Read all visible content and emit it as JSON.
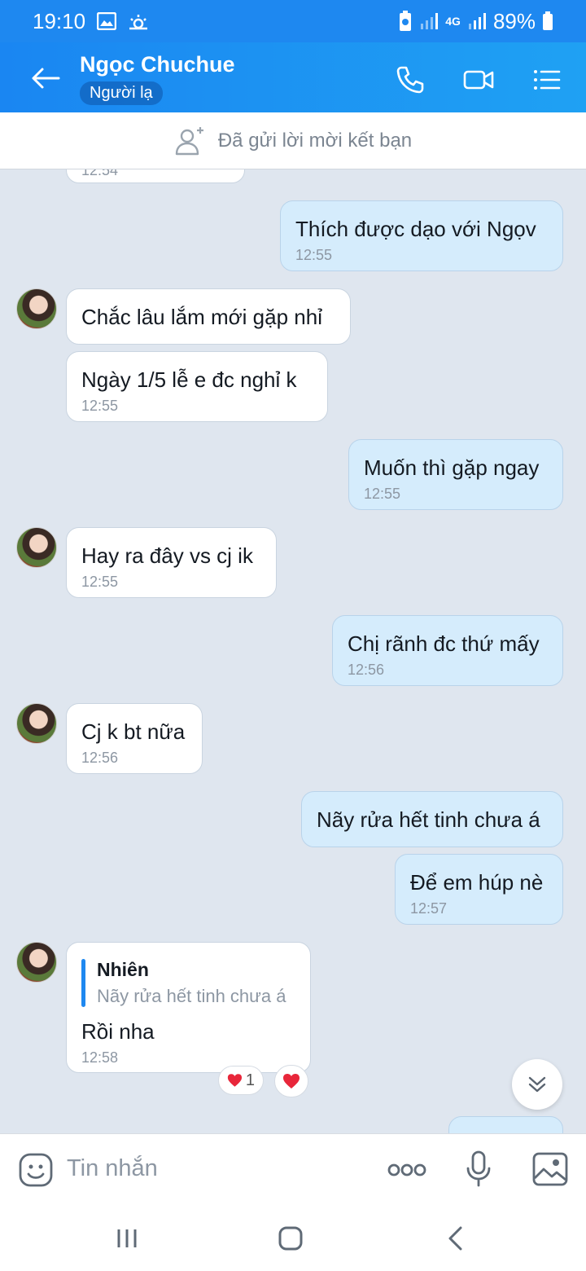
{
  "status_bar": {
    "time": "19:10",
    "network": "4G",
    "battery": "89%"
  },
  "header": {
    "name": "Ngọc Chuchue",
    "badge": "Người lạ"
  },
  "friend_request": {
    "text": "Đã gửi lời mời kết bạn"
  },
  "messages": [
    {
      "dir": "in",
      "text": "",
      "time": "12:54"
    },
    {
      "dir": "out",
      "text": "Thích được dạo với Ngọv",
      "time": "12:55"
    },
    {
      "dir": "in",
      "text": "Chắc lâu lắm mới gặp nhỉ",
      "time": ""
    },
    {
      "dir": "in",
      "text": "Ngày 1/5 lễ e đc nghỉ k",
      "time": "12:55"
    },
    {
      "dir": "out",
      "text": "Muốn thì gặp ngay",
      "time": "12:55"
    },
    {
      "dir": "in",
      "text": "Hay ra đây vs cj ik",
      "time": "12:55"
    },
    {
      "dir": "out",
      "text": "Chị rãnh đc thứ mấy",
      "time": "12:56"
    },
    {
      "dir": "in",
      "text": "Cj k bt nữa",
      "time": "12:56"
    },
    {
      "dir": "out",
      "text": "Nãy rửa hết tinh chưa á",
      "time": ""
    },
    {
      "dir": "out",
      "text": "Để em húp nè",
      "time": "12:57"
    },
    {
      "dir": "in",
      "text": "Rồi nha",
      "time": "12:58",
      "quote": {
        "name": "Nhiên",
        "text": "Nãy rửa hết tinh chưa á"
      }
    }
  ],
  "reactions": {
    "heart_count": "1"
  },
  "input": {
    "placeholder": "Tin nhắn"
  },
  "colors": {
    "header": "#1e88f0",
    "outgoing_bubble": "#d5ecfc",
    "incoming_bubble": "#ffffff",
    "chat_bg": "#dfe6ef",
    "heart": "#e8263a"
  },
  "icons": [
    "back-arrow-icon",
    "phone-icon",
    "video-call-icon",
    "menu-list-icon",
    "add-friend-icon",
    "sticker-icon",
    "more-icon",
    "microphone-icon",
    "image-icon",
    "chevron-down-icon"
  ]
}
